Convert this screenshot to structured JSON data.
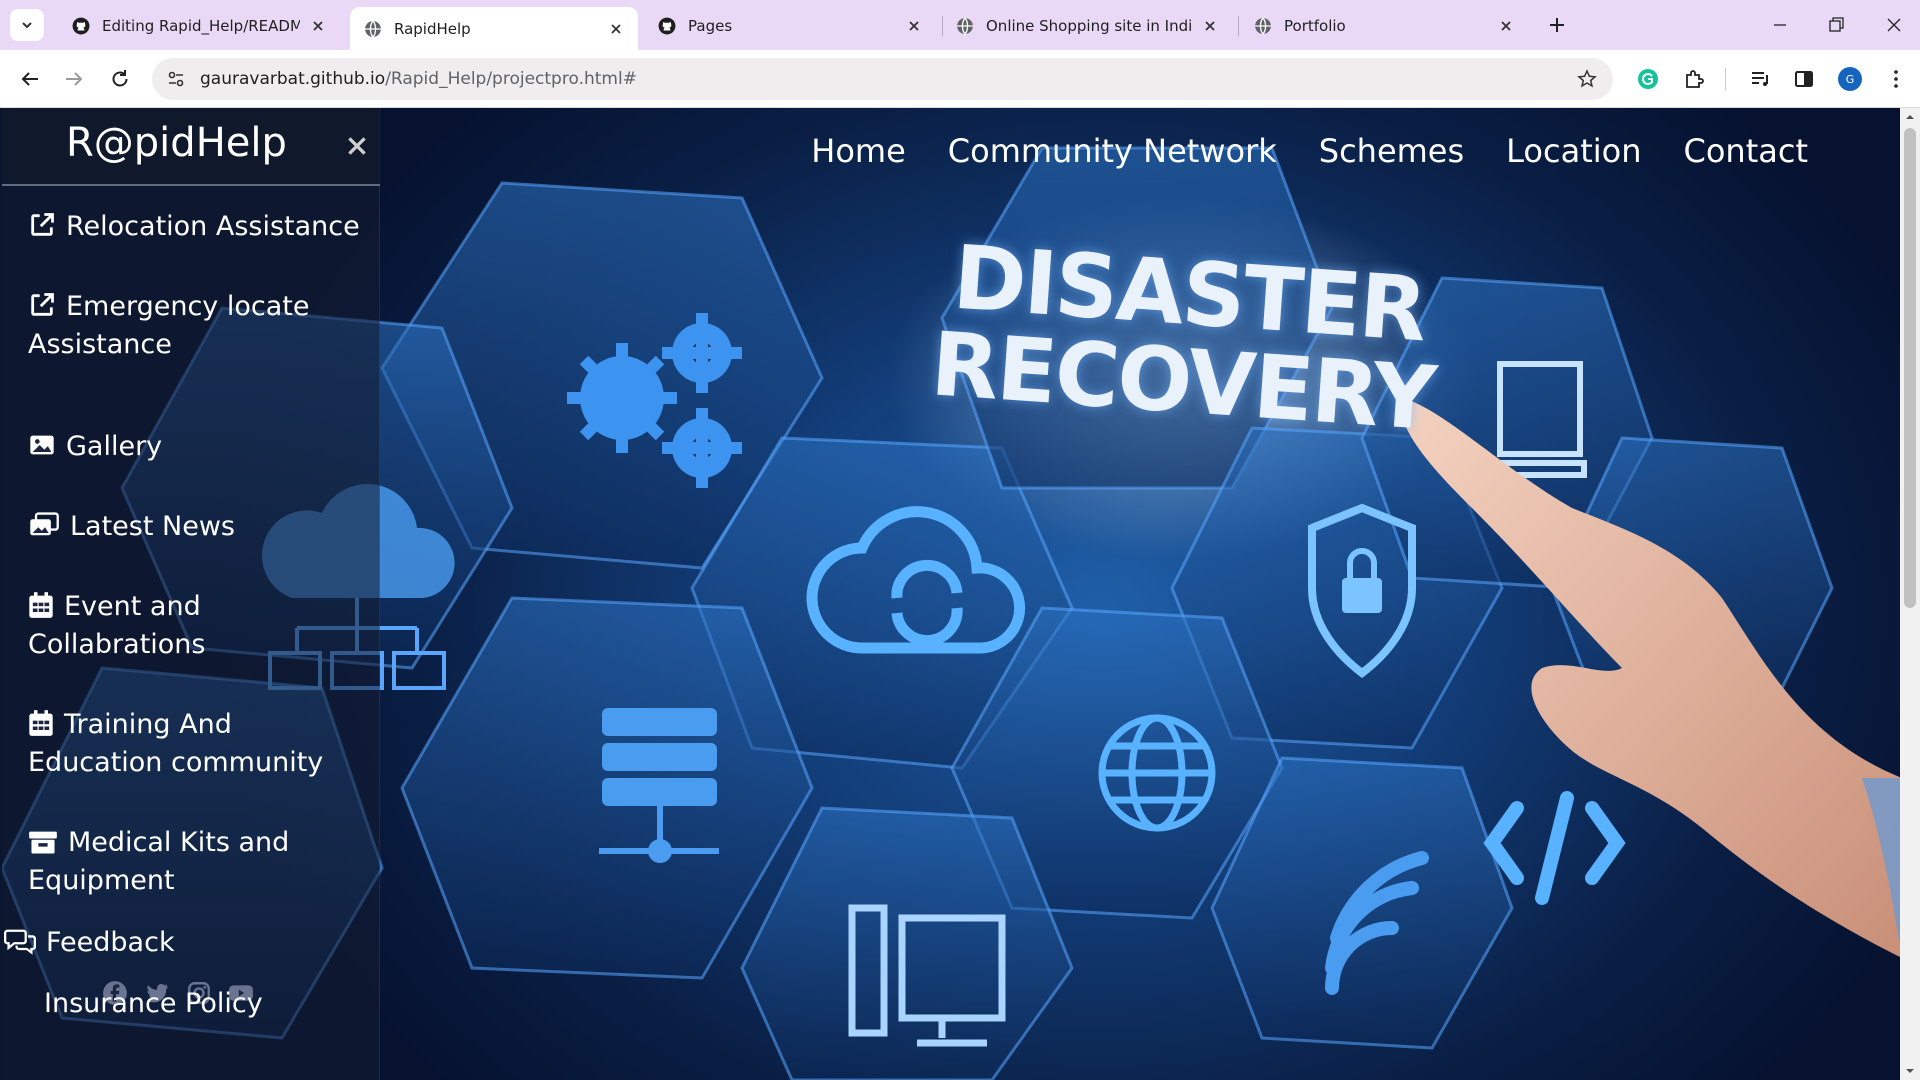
{
  "browser": {
    "tabs": [
      {
        "title": "Editing Rapid_Help/README.m",
        "icon": "github-icon",
        "active": false
      },
      {
        "title": "RapidHelp",
        "icon": "globe-icon",
        "active": true
      },
      {
        "title": "Pages",
        "icon": "github-icon",
        "active": false
      },
      {
        "title": "Online Shopping site in India: S",
        "icon": "globe-icon",
        "active": false
      },
      {
        "title": "Portfolio",
        "icon": "globe-icon",
        "active": false
      }
    ],
    "url_domain": "gauravarbat.github.io",
    "url_path": "/Rapid_Help/projectpro.html#",
    "avatar_letter": "G"
  },
  "page": {
    "hero": {
      "line1": "DISASTER",
      "line2": "RECOVERY"
    },
    "nav": [
      "Home",
      "Community Network",
      "Schemes",
      "Location",
      "Contact"
    ],
    "sidebar": {
      "brand": "R@pidHelp",
      "items": [
        {
          "label": "Relocation Assistance",
          "icon": "external-link-icon"
        },
        {
          "label": "Emergency locate Assistance",
          "icon": "external-link-icon"
        },
        {
          "label": "Gallery",
          "icon": "image-icon"
        },
        {
          "label": "Latest News",
          "icon": "images-icon"
        },
        {
          "label": "Event and Collabrations",
          "icon": "calendar-icon"
        },
        {
          "label": "Training And Education community",
          "icon": "calendar-icon"
        },
        {
          "label": "Medical Kits and Equipment",
          "icon": "box-icon"
        },
        {
          "label": "Feedback",
          "icon": "comments-icon"
        }
      ],
      "insurance": "Insurance Policy",
      "social": [
        "facebook-icon",
        "twitter-icon",
        "instagram-icon",
        "youtube-icon"
      ]
    }
  },
  "colors": {
    "tabbar": "#e9d9f6",
    "accent": "#1565c0",
    "sidebar": "#141c30"
  }
}
